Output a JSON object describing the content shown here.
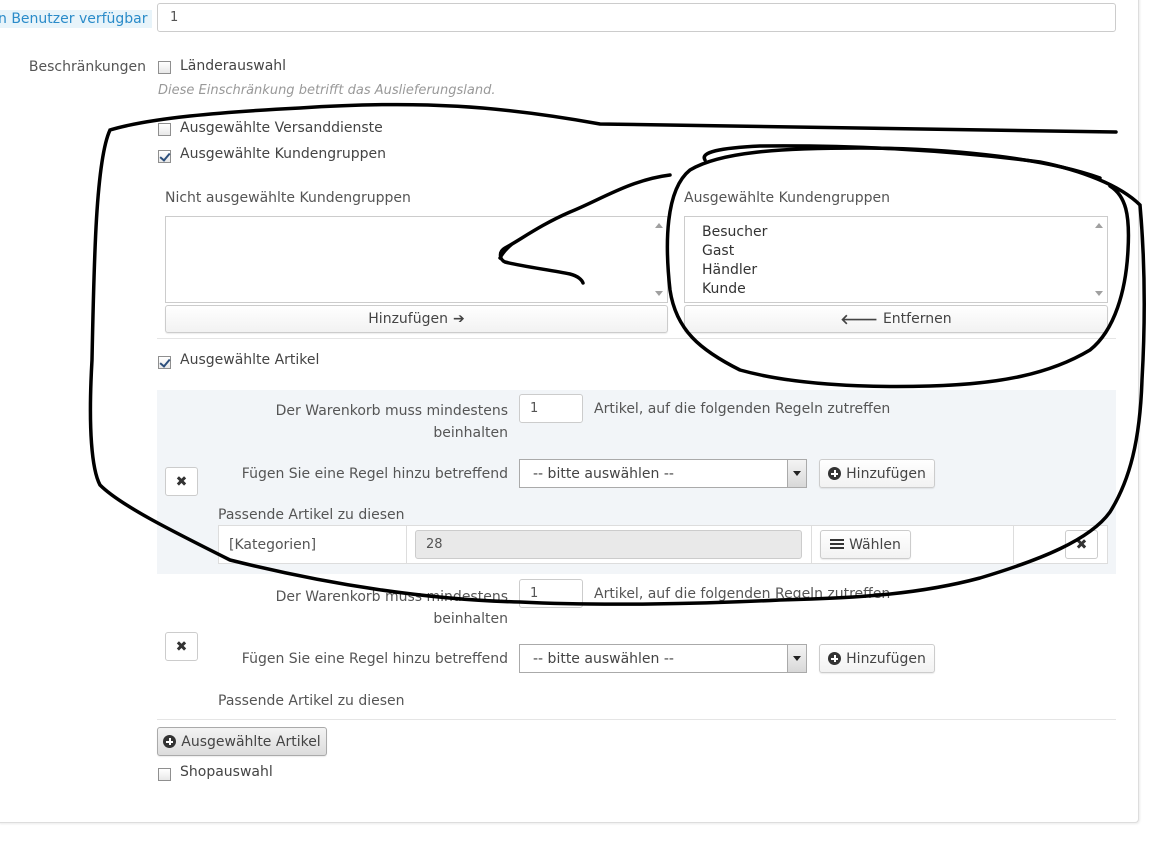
{
  "top_field": {
    "label": "n Benutzer verfügbar",
    "value": "1"
  },
  "restrictions": {
    "label": "Beschränkungen",
    "country": {
      "label": "Länderauswahl",
      "checked": false,
      "hint": "Diese Einschränkung betrifft das Auslieferungsland."
    },
    "carriers": {
      "label": "Ausgewählte Versanddienste",
      "checked": false
    },
    "groups": {
      "label": "Ausgewählte Kundengruppen",
      "checked": true,
      "unselected_title": "Nicht ausgewählte Kundengruppen",
      "selected_title": "Ausgewählte Kundengruppen",
      "selected_items": [
        "Besucher",
        "Gast",
        "Händler",
        "Kunde"
      ],
      "add_label": "Hinzufügen",
      "remove_label": "Entfernen"
    },
    "products": {
      "label": "Ausgewählte Artikel",
      "checked": true,
      "rule_groups": [
        {
          "min_label": "Der Warenkorb muss mindestens beinhalten",
          "min_value": "1",
          "suffix": "Artikel, auf die folgenden Regeln zutreffen",
          "rule_label": "Fügen Sie eine Regel hinzu betreffend",
          "select_value": "-- bitte auswählen --",
          "add_label": "Hinzufügen",
          "matching_label": "Passende Artikel zu diesen",
          "rules": [
            {
              "type": "[Kategorien]",
              "value": "28",
              "choose_label": "Wählen"
            }
          ]
        },
        {
          "min_label": "Der Warenkorb muss mindestens beinhalten",
          "min_value": "1",
          "suffix": "Artikel, auf die folgenden Regeln zutreffen",
          "rule_label": "Fügen Sie eine Regel hinzu betreffend",
          "select_value": "-- bitte auswählen --",
          "add_label": "Hinzufügen",
          "matching_label": "Passende Artikel zu diesen",
          "rules": []
        }
      ],
      "add_group_label": "Ausgewählte Artikel"
    },
    "shop": {
      "label": "Shopauswahl",
      "checked": false
    }
  },
  "icons": {
    "add": "circle-plus-icon",
    "remove_rule": "close-icon",
    "list": "list-icon",
    "arrow_right": "arrow-right-icon",
    "arrow_left": "arrow-left-icon"
  }
}
